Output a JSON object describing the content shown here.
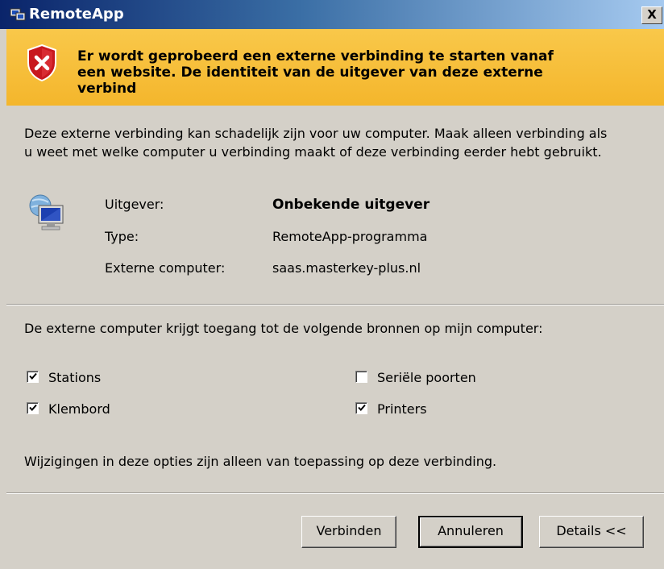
{
  "window": {
    "title": "RemoteApp",
    "close_label": "X"
  },
  "warning": {
    "line1": "Er wordt geprobeerd een externe verbinding te starten vanaf",
    "line2": "een website. De identiteit van de uitgever van deze externe",
    "line3": "verbind",
    "icon": "shield-error-icon",
    "color": "#f6be36"
  },
  "description": {
    "line1": "Deze externe verbinding kan schadelijk zijn voor uw computer. Maak alleen verbinding als",
    "line2": "u weet met welke computer u verbinding maakt of deze verbinding eerder hebt gebruikt."
  },
  "details": {
    "icon": "remote-computer-icon",
    "rows": [
      {
        "label": "Uitgever:",
        "value": "Onbekende uitgever"
      },
      {
        "label": "Type:",
        "value": "RemoteApp-programma"
      },
      {
        "label": "Externe computer:",
        "value": "saas.masterkey-plus.nl"
      }
    ]
  },
  "resources": {
    "heading": "De externe computer krijgt toegang tot de volgende bronnen op mijn computer:",
    "options": [
      {
        "label": "Stations",
        "checked": true
      },
      {
        "label": "Seriële poorten",
        "checked": false
      },
      {
        "label": "Klembord",
        "checked": true
      },
      {
        "label": "Printers",
        "checked": true
      }
    ],
    "note": "Wijzigingen in deze opties zijn alleen van toepassing op deze verbinding."
  },
  "buttons": {
    "connect": "Verbinden",
    "cancel": "Annuleren",
    "details": "Details <<"
  }
}
